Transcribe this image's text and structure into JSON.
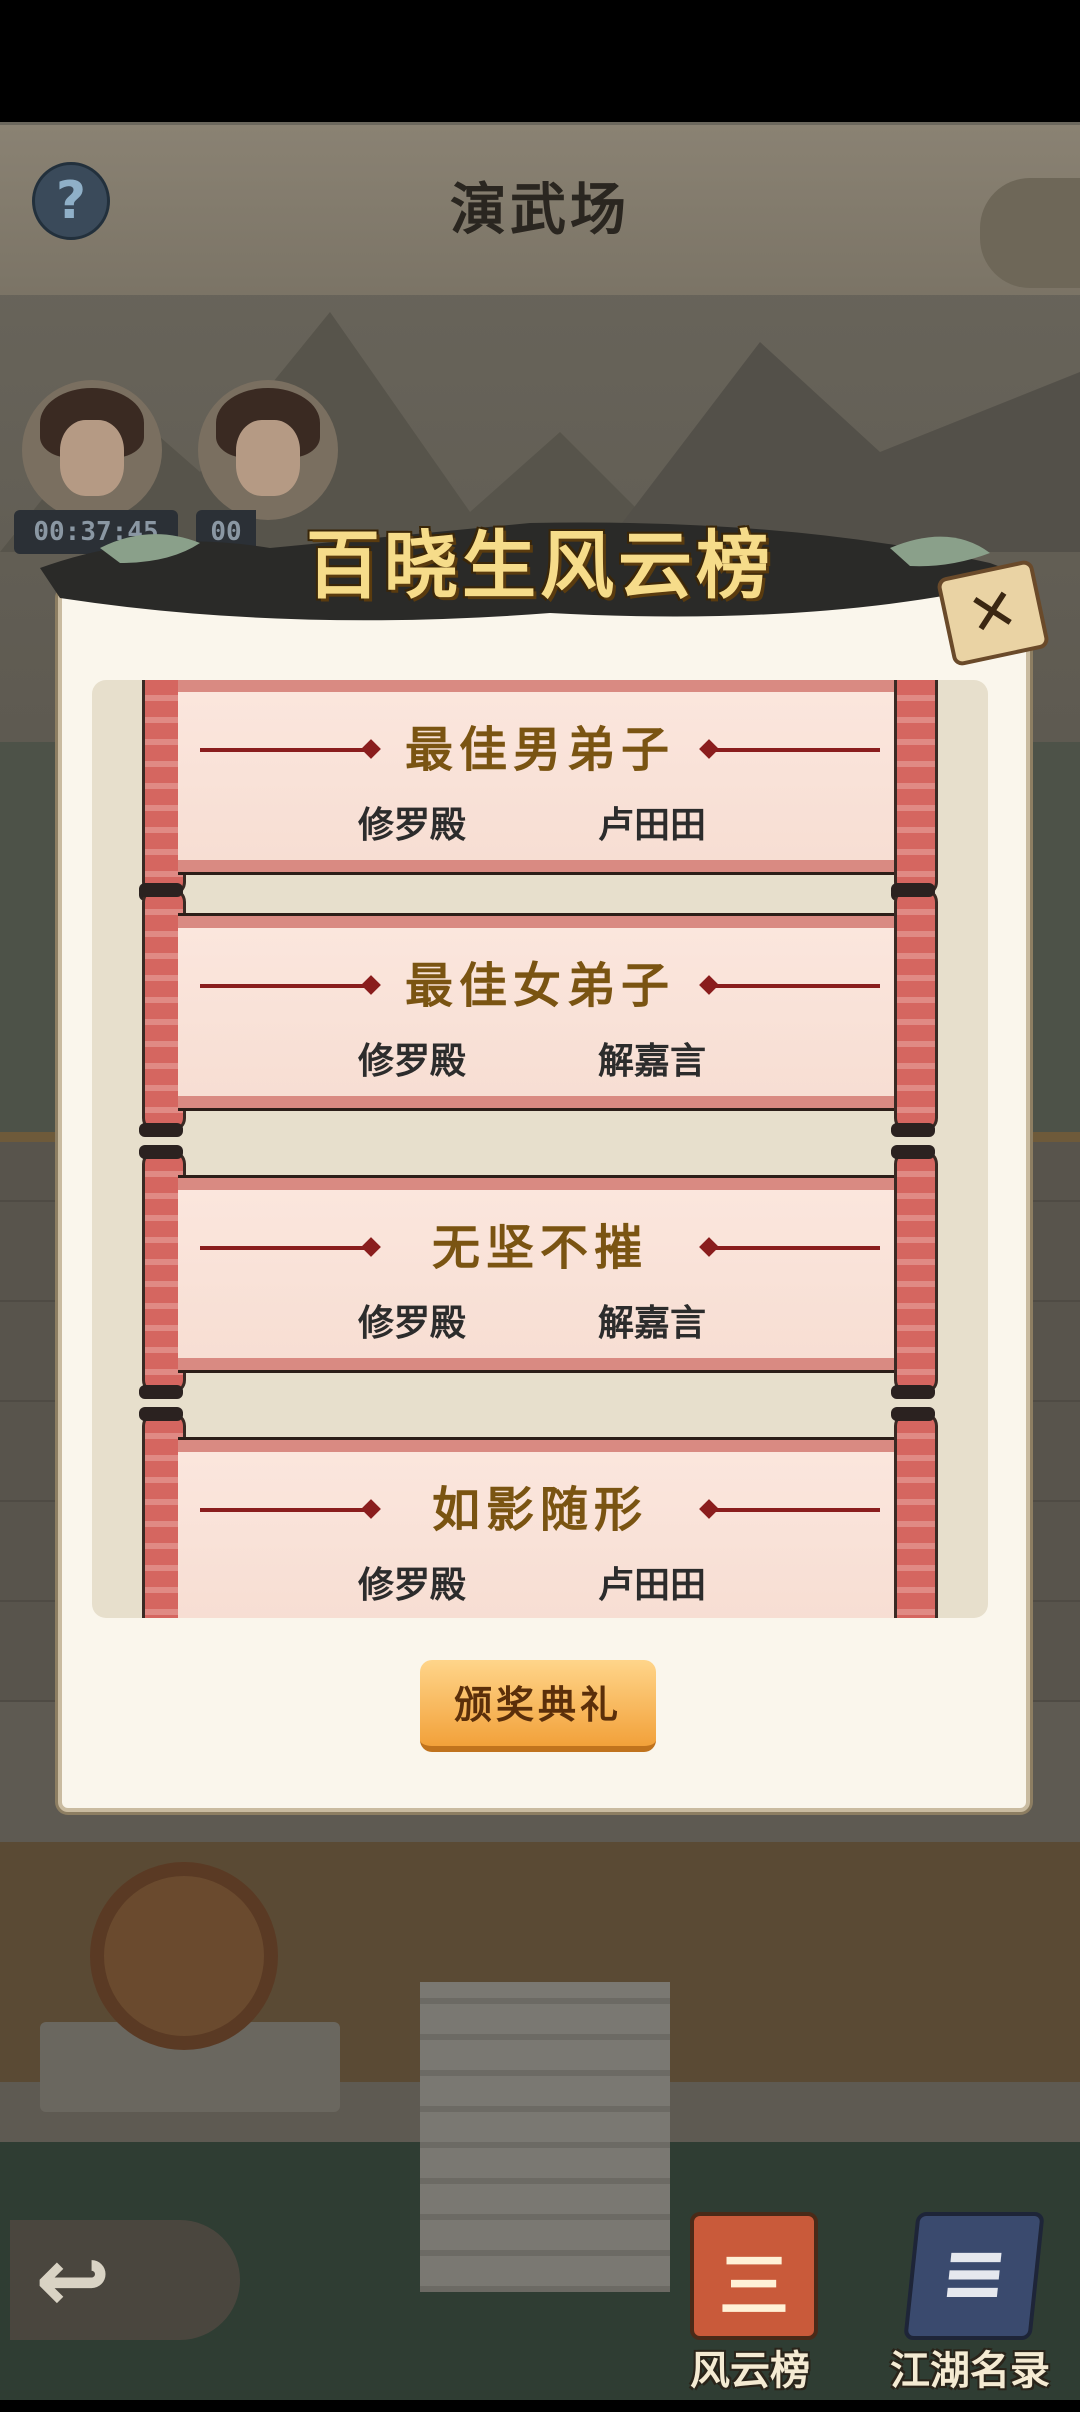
{
  "header": {
    "title": "演武场",
    "help_icon": "question-icon"
  },
  "players": {
    "timer_1": "00:37:45",
    "timer_2_partial": "00"
  },
  "dialog": {
    "title": "百晓生风云榜",
    "close_icon": "close-icon",
    "awards": [
      {
        "title": "最佳男弟子",
        "sect": "修罗殿",
        "name": "卢田田"
      },
      {
        "title": "最佳女弟子",
        "sect": "修罗殿",
        "name": "解嘉言"
      },
      {
        "title": "无坚不摧",
        "sect": "修罗殿",
        "name": "解嘉言"
      },
      {
        "title": "如影随形",
        "sect": "修罗殿",
        "name": "卢田田"
      }
    ],
    "ceremony_button": "颁奖典礼"
  },
  "bottom_nav": {
    "back_icon": "back-arrow-icon",
    "ranking_label": "风云榜",
    "jianghu_label": "江湖名录"
  },
  "colors": {
    "accent_gold": "#f6dc8a",
    "button_orange": "#f2a13a",
    "scroll_red": "#d56660",
    "panel_cream": "#faf6ec"
  }
}
